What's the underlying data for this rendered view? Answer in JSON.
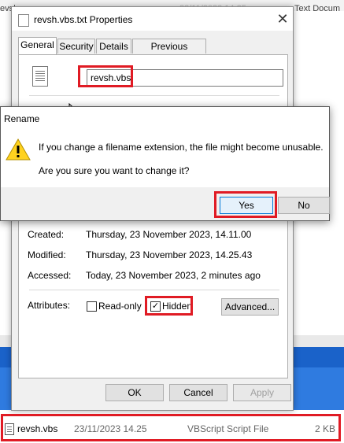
{
  "background": {
    "top_left_text": "evs|",
    "top_mid_text": "23/11/2023 14.25",
    "top_right_text": "Text Docum"
  },
  "properties": {
    "title": "revsh.vbs.txt Properties",
    "tabs": [
      "General",
      "Security",
      "Details",
      "Previous Versions"
    ],
    "filename": "revsh.vbs",
    "created_label": "Created:",
    "created_value": "Thursday, 23 November 2023, 14.11.00",
    "modified_label": "Modified:",
    "modified_value": "Thursday, 23 November 2023, 14.25.43",
    "accessed_label": "Accessed:",
    "accessed_value": "Today, 23 November 2023, 2 minutes ago",
    "attributes_label": "Attributes:",
    "readonly_label": "Read-only",
    "hidden_label": "Hidden",
    "advanced_label": "Advanced...",
    "ok_label": "OK",
    "cancel_label": "Cancel",
    "apply_label": "Apply"
  },
  "rename": {
    "title": "Rename",
    "message1": "If you change a filename extension, the file might become unusable.",
    "message2": "Are you sure you want to change it?",
    "yes_label": "Yes",
    "no_label": "No"
  },
  "file_row": {
    "name": "revsh.vbs",
    "date": "23/11/2023 14.25",
    "type": "VBScript Script File",
    "size": "2 KB"
  },
  "colors": {
    "highlight": "#e01b24",
    "accent": "#0078d7",
    "taskbar": "#1a62c9"
  }
}
